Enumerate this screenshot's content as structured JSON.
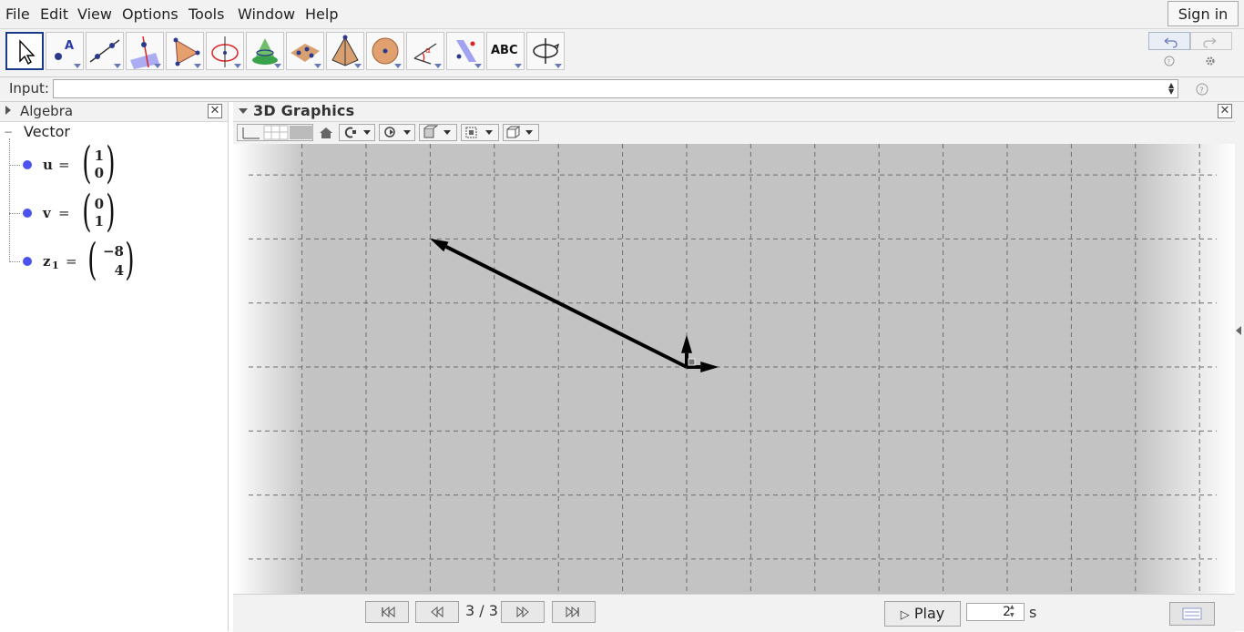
{
  "menu": {
    "items": [
      "File",
      "Edit",
      "View",
      "Options",
      "Tools",
      "Window",
      "Help"
    ],
    "sign_in": "Sign in"
  },
  "toolbar": {
    "tools": [
      "move-tool",
      "point-tool",
      "line-tool",
      "perpendicular-line-tool",
      "polygon-tool",
      "circle-tool",
      "intersect-tool",
      "plane-tool",
      "pyramid-tool",
      "sphere-tool",
      "angle-tool",
      "reflect-tool",
      "text-tool",
      "rotate-view-tool"
    ],
    "text_tool_label": "ABC"
  },
  "input": {
    "label": "Input:",
    "value": ""
  },
  "algebra": {
    "title": "Algebra",
    "group": "Vector",
    "items": [
      {
        "name": "u",
        "x": "1",
        "y": "0"
      },
      {
        "name": "v",
        "x": "0",
        "y": "1"
      },
      {
        "name": "z",
        "subscript": "1",
        "x": "−8",
        "y": "4"
      }
    ],
    "dot_color": "#4b52ee"
  },
  "graphics3d": {
    "title": "3D Graphics",
    "vectors": [
      {
        "name": "u",
        "x": 1,
        "y": 0
      },
      {
        "name": "v",
        "x": 0,
        "y": 1
      },
      {
        "name": "z_1",
        "x": -8,
        "y": 4
      }
    ]
  },
  "bottom": {
    "page": "3 / 3",
    "play": "Play",
    "speed": "2",
    "unit": "s"
  },
  "colors": {
    "plane": "#c3c3c3",
    "vector": "#000000",
    "selected_tool_border": "#1b3a8a"
  }
}
